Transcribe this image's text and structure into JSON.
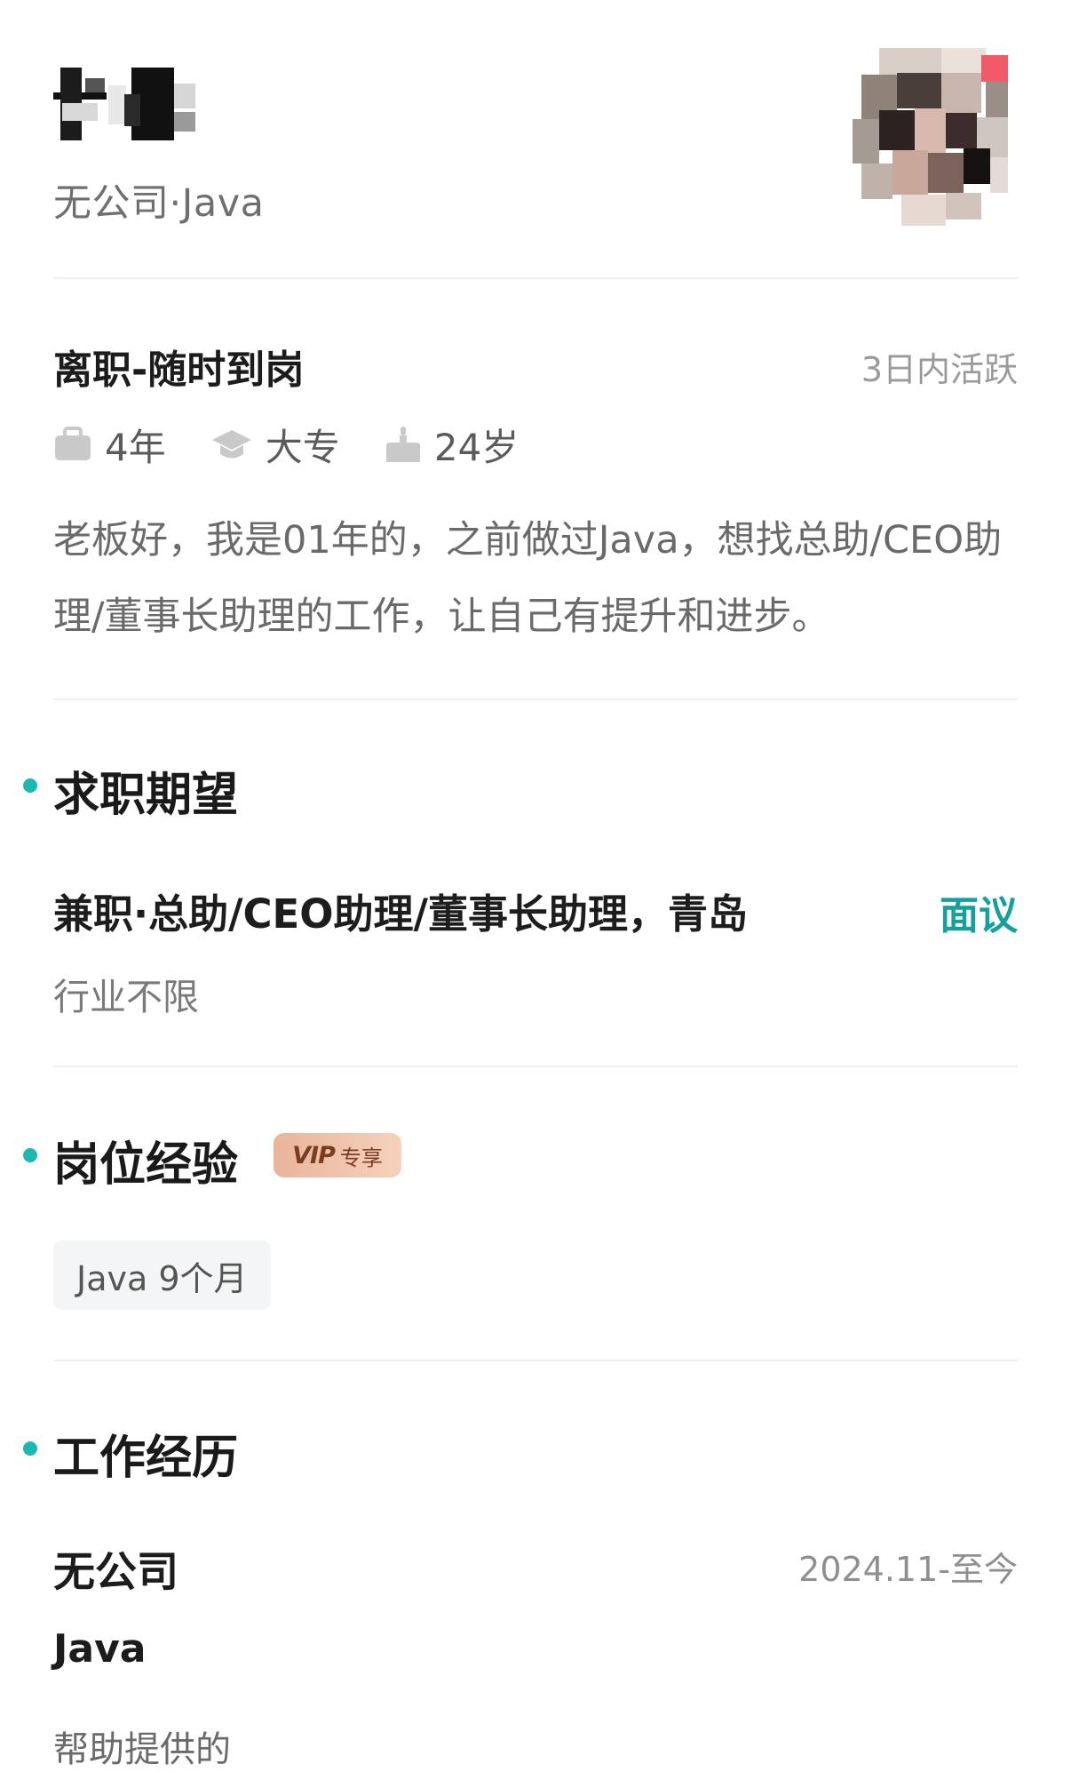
{
  "header": {
    "company_role": "无公司·Java"
  },
  "status": {
    "title": "离职-随时到岗",
    "active": "3日内活跃"
  },
  "meta": {
    "experience": "4年",
    "education": "大专",
    "age": "24岁"
  },
  "intro": "老板好，我是01年的，之前做过Java，想找总助/CEO助理/董事长助理的工作，让自己有提升和进步。",
  "expectation": {
    "section_title": "求职期望",
    "main": "兼职·总助/CEO助理/董事长助理，青岛",
    "salary": "面议",
    "industry": "行业不限"
  },
  "experience_section": {
    "section_title": "岗位经验",
    "vip_mark": "VIP",
    "vip_text": "专享",
    "tags": [
      "Java 9个月"
    ]
  },
  "work_history": {
    "section_title": "工作经历",
    "company": "无公司",
    "period": "2024.11-至今",
    "position": "Java",
    "description": "帮助提供的"
  },
  "colors": {
    "accent": "#1fb8b1",
    "salary": "#14a19b",
    "vip_bg": "#f0c3ab"
  }
}
